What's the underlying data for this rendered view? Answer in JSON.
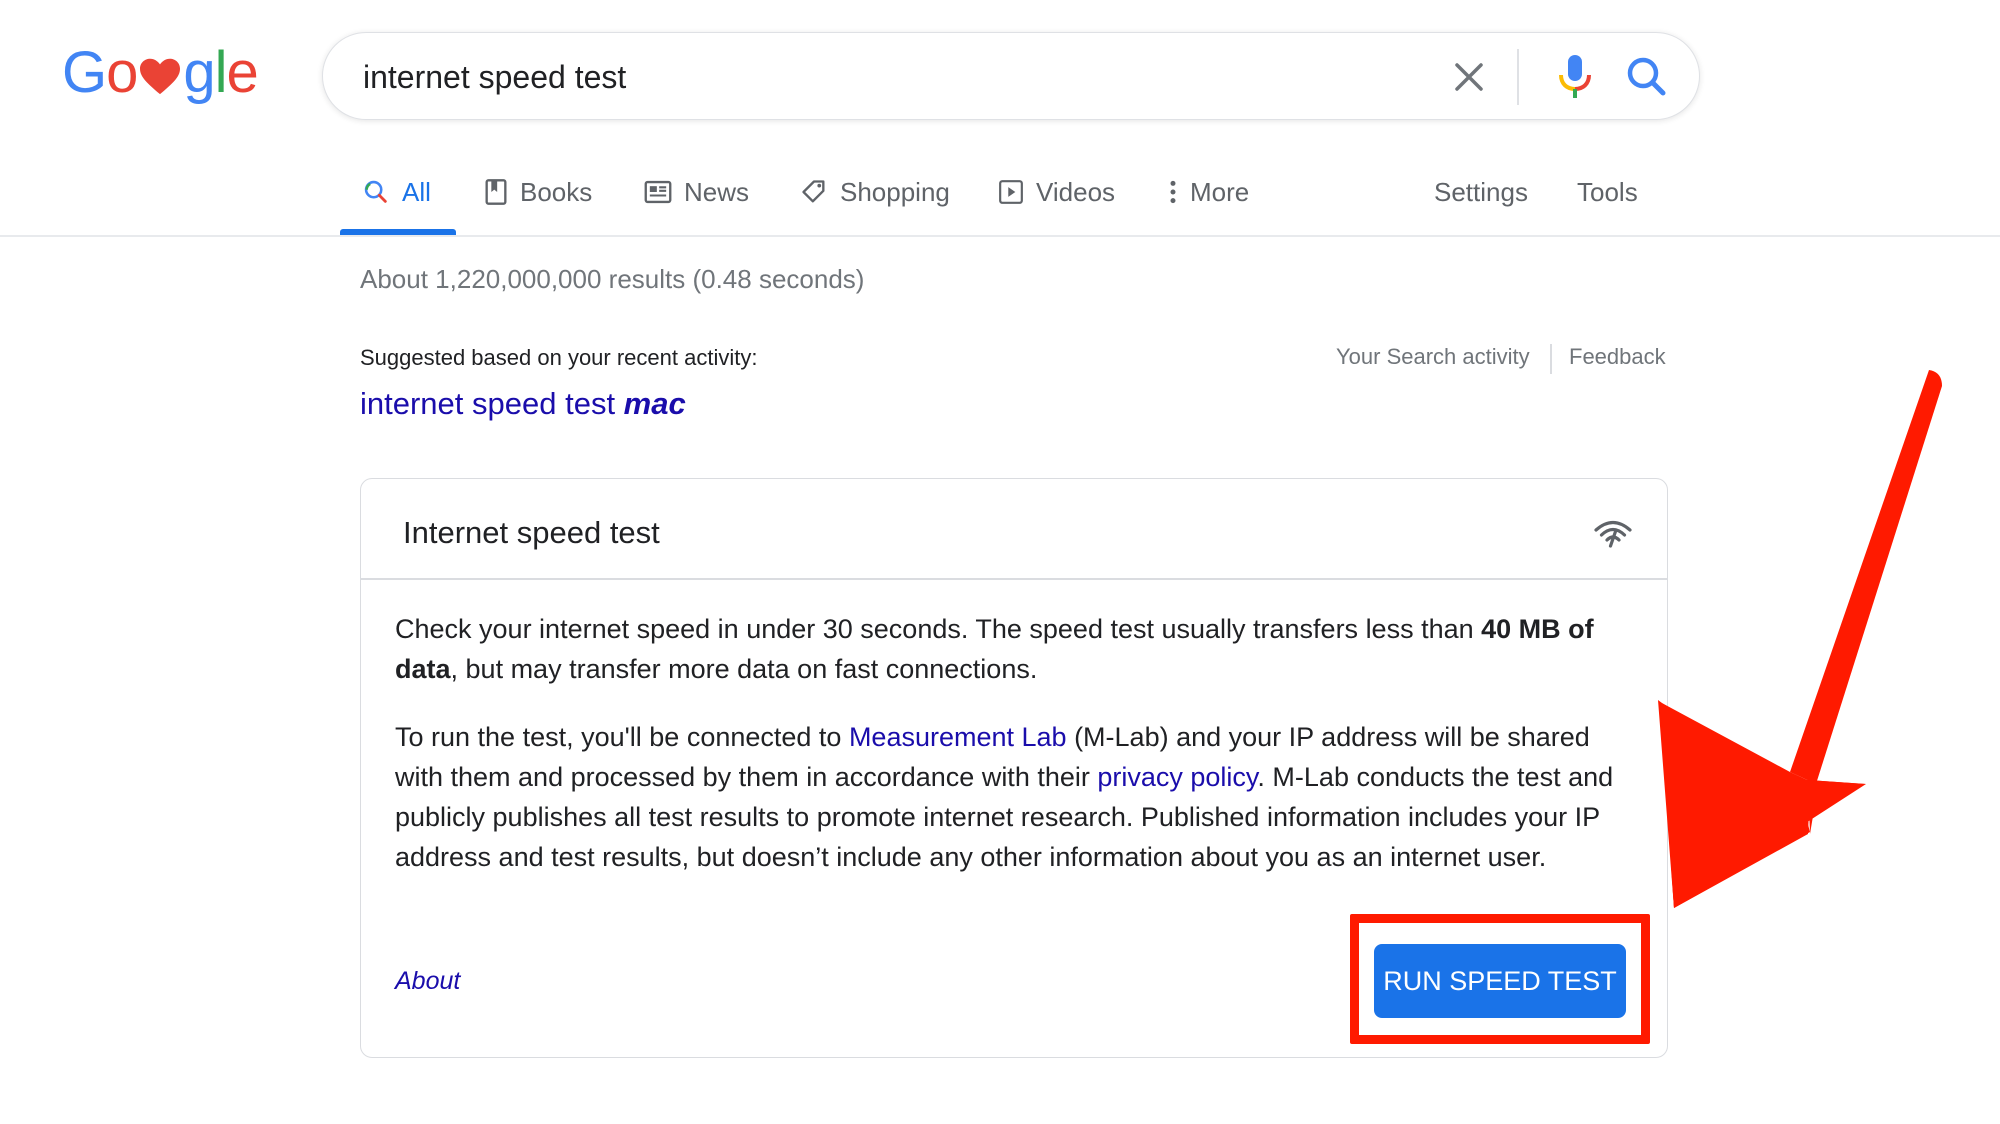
{
  "logo": {
    "letters": [
      "G",
      "o",
      "g",
      "l",
      "e"
    ]
  },
  "search": {
    "query": "internet speed test"
  },
  "tabs": [
    {
      "label": "All",
      "icon": "search-icon"
    },
    {
      "label": "Books",
      "icon": "book-icon"
    },
    {
      "label": "News",
      "icon": "news-icon"
    },
    {
      "label": "Shopping",
      "icon": "tag-icon"
    },
    {
      "label": "Videos",
      "icon": "play-icon"
    },
    {
      "label": "More",
      "icon": "more-vert-icon"
    }
  ],
  "tools": {
    "settings": "Settings",
    "tools": "Tools"
  },
  "result_stats": "About 1,220,000,000 results (0.48 seconds)",
  "suggestion": {
    "label": "Suggested based on your recent activity:",
    "query_plain": "internet speed test ",
    "query_bold": "mac",
    "activity_link": "Your Search activity",
    "feedback_link": "Feedback"
  },
  "card": {
    "title": "Internet speed test",
    "icon": "wifi-signal-icon",
    "para1": {
      "a": "Check your internet speed in under 30 seconds. The speed test usually transfers less than ",
      "bold": "40 MB of data",
      "b": ", but may transfer more data on fast connections."
    },
    "para2": {
      "a": "To run the test, you'll be connected to ",
      "link1": "Measurement Lab",
      "b": " (M-Lab) and your IP address will be shared with them and processed by them in accordance with their ",
      "link2": "privacy policy",
      "c": ". M-Lab conducts the test and publicly publishes all test results to promote internet research. Published information includes your IP address and test results, but doesn’t include any other information about you as an internet user."
    },
    "about": "About",
    "button": "RUN SPEED TEST"
  },
  "colors": {
    "accent": "#1a73e8",
    "link": "#1a0dab",
    "highlight": "#ff1a00",
    "button": "#1a73e8"
  }
}
